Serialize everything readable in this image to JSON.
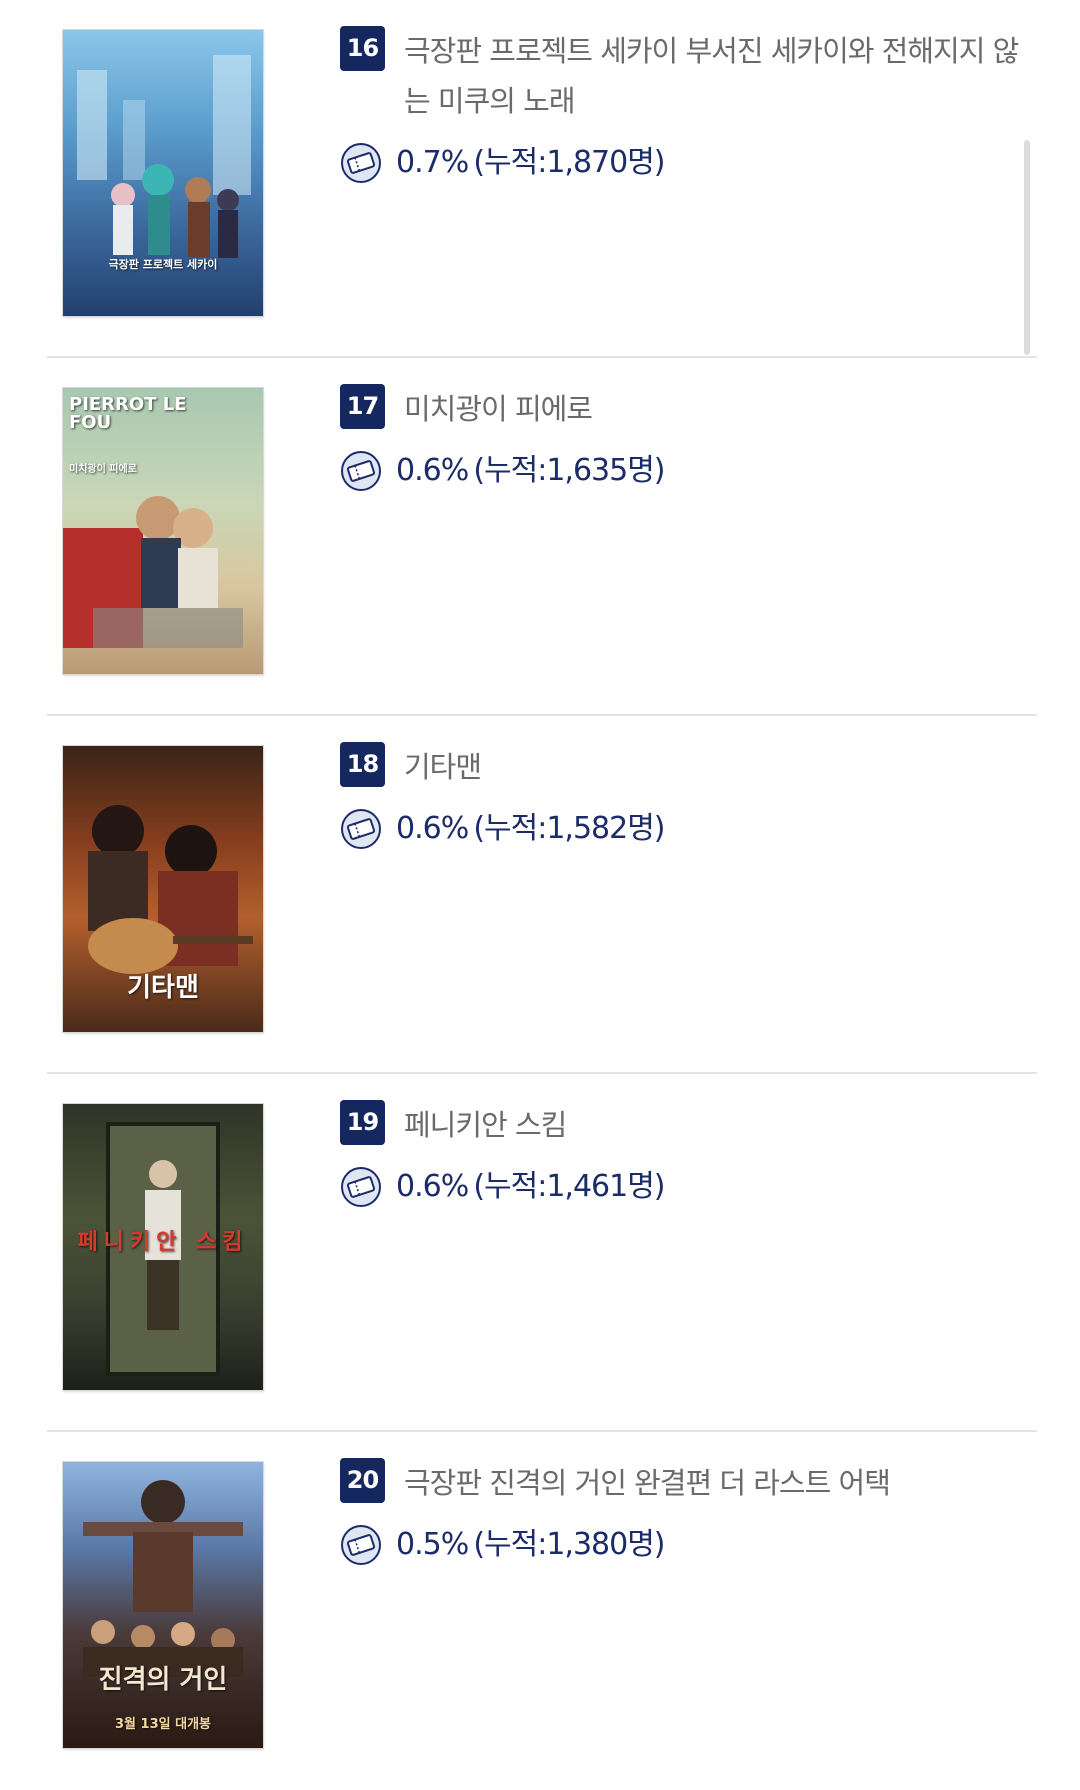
{
  "items": [
    {
      "rank": "16",
      "title": "극장판 프로젝트 세카이 부서진 세카이와 전해지지 않는 미쿠의 노래",
      "share": "0.7%",
      "cumulative": "(누적:1,870명)",
      "poster_text": "극장판 프로젝트 세카이",
      "poster_colors": [
        "#6fb3d9",
        "#2a4f86"
      ],
      "icon": "ticket-icon"
    },
    {
      "rank": "17",
      "title": "미치광이 피에로",
      "share": "0.6%",
      "cumulative": "(누적:1,635명)",
      "poster_text": "PIERROT LE FOU",
      "poster_subtext": "미치광이 피에로",
      "poster_colors": [
        "#9cbfa3",
        "#e1d0a9"
      ],
      "icon": "ticket-icon"
    },
    {
      "rank": "18",
      "title": "기타맨",
      "share": "0.6%",
      "cumulative": "(누적:1,582명)",
      "poster_text": "기타맨",
      "poster_colors": [
        "#a5552c",
        "#3c2116"
      ],
      "icon": "ticket-icon"
    },
    {
      "rank": "19",
      "title": "페니키안 스킴",
      "share": "0.6%",
      "cumulative": "(누적:1,461명)",
      "poster_text": "페니키안 스킴",
      "poster_colors": [
        "#4a5238",
        "#22261a"
      ],
      "icon": "ticket-icon"
    },
    {
      "rank": "20",
      "title": "극장판 진격의 거인 완결편 더 라스트 어택",
      "share": "0.5%",
      "cumulative": "(누적:1,380명)",
      "poster_text": "진격의 거인",
      "poster_subtext": "3월 13일 대개봉",
      "poster_colors": [
        "#7fa7d6",
        "#3b2418"
      ],
      "icon": "ticket-icon"
    }
  ],
  "colors": {
    "rank_bg": "#15275f",
    "stat_text": "#1c2c6a",
    "title_text": "#6a6a6a",
    "divider": "#e3e3e3"
  }
}
